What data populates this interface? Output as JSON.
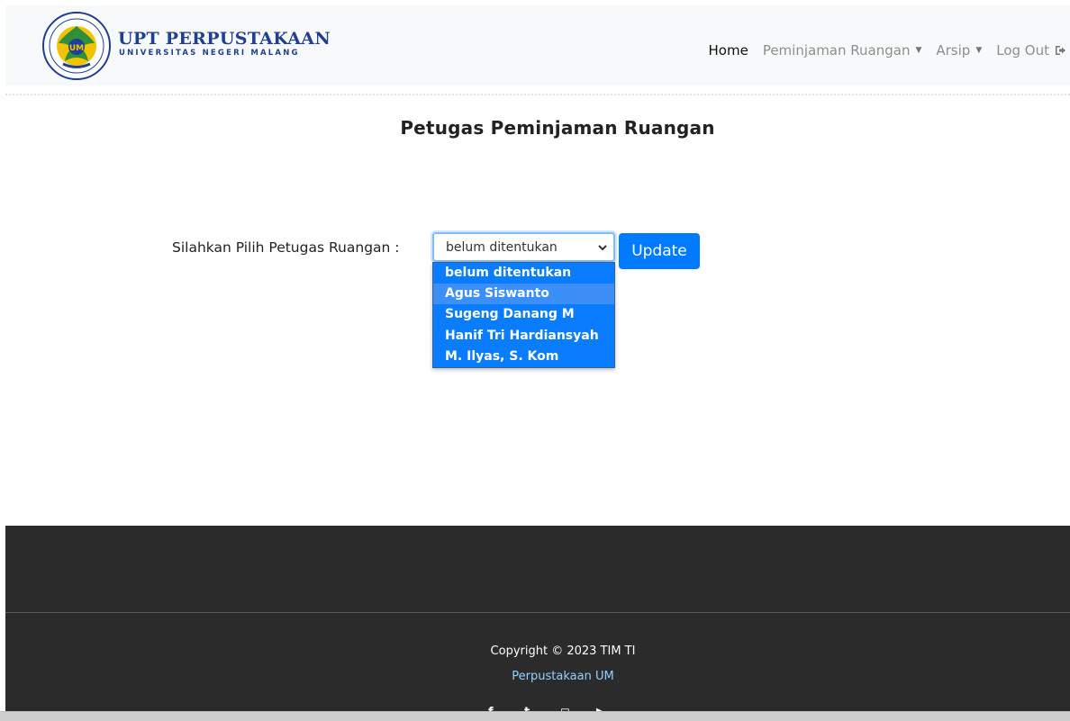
{
  "header": {
    "brand_title": "UPT PERPUSTAKAAN",
    "brand_subtitle": "UNIVERSITAS NEGERI MALANG",
    "nav": {
      "home": "Home",
      "peminjaman": "Peminjaman Ruangan",
      "arsip": "Arsip",
      "logout": "Log Out"
    }
  },
  "main": {
    "title": "Petugas Peminjaman Ruangan",
    "form_label": "Silahkan Pilih Petugas Ruangan :",
    "select_value": "belum ditentukan",
    "update_button": "Update",
    "options": [
      "belum ditentukan",
      "Agus Siswanto",
      "Sugeng Danang M",
      "Hanif Tri Hardiansyah",
      "M. Ilyas, S. Kom"
    ],
    "hovered_option": "Agus Siswanto"
  },
  "footer": {
    "copyright": "Copyright © 2023 TIM TI",
    "link": "Perpustakaan UM"
  },
  "colors": {
    "brand": "#1f3f95",
    "primary": "#007bff",
    "footer_bg": "#2b2b2b",
    "footer_link": "#8fd3ff"
  },
  "icons": {
    "logo": "university-seal-logo",
    "caret": "caret-down-icon",
    "logout": "sign-out-icon",
    "select": "chevron-down-icon",
    "social": [
      "facebook-icon",
      "twitter-icon",
      "instagram-icon",
      "youtube-icon"
    ]
  }
}
